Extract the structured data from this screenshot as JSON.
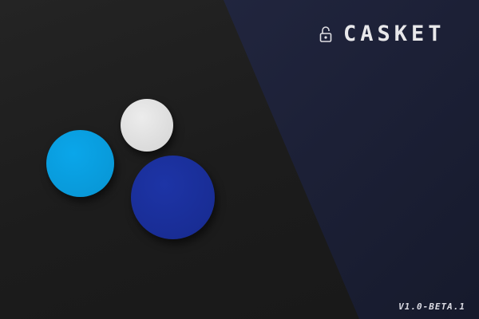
{
  "app": {
    "title": "CASKET",
    "version": "V1.0-BETA.1"
  },
  "colors": {
    "left_bg": "#1c1c1c",
    "right_bg": "#1f2339",
    "cyan": "#0aa0e0",
    "white": "#e0e0e0",
    "blue": "#1a2fa0"
  },
  "icons": {
    "brand": "unlocked-padlock-icon"
  }
}
